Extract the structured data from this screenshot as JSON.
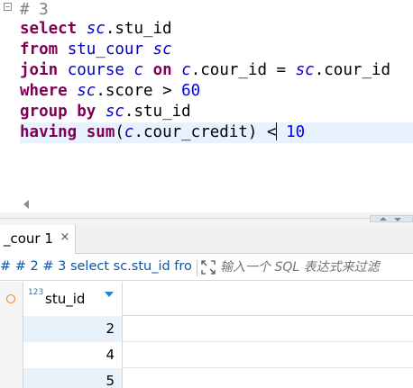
{
  "editor": {
    "line1": {
      "comment": "# 3"
    },
    "line2": {
      "kw1": "select",
      "alias": "sc",
      "rest": ".stu_id"
    },
    "line3": {
      "kw1": "from",
      "table": "stu_cour",
      "alias": "sc"
    },
    "line4": {
      "kw1": "join",
      "table": "course",
      "alias1": "c",
      "kw2": "on",
      "alias2": "c",
      "mid": ".cour_id = ",
      "alias3": "sc",
      "rest": ".cour_id"
    },
    "line5": {
      "kw1": "where",
      "alias": "sc",
      "rest": ".score > ",
      "num": "60"
    },
    "line6": {
      "kw1": "group by",
      "alias": "sc",
      "rest": ".stu_id"
    },
    "line7": {
      "kw1": "having",
      "func": "sum",
      "open": "(",
      "alias": "c",
      "rest": ".cour_credit) <",
      "num": "10"
    }
  },
  "results_tab": {
    "label": "_cour 1",
    "close": "×"
  },
  "filter_bar": {
    "query_text": "# # 2 # 3 select sc.stu_id fro",
    "placeholder": "输入一个 SQL 表达式来过滤"
  },
  "grid": {
    "column": {
      "type_badge": "123",
      "name": "stu_id"
    },
    "rows": [
      {
        "value": "2"
      },
      {
        "value": "4"
      },
      {
        "value": "5"
      }
    ]
  },
  "colors": {
    "keyword": "#7f0055",
    "alias": "#0000c0",
    "number": "#0000ff",
    "comment": "#808080",
    "query_link": "#0c55a8",
    "selection": "#e9f1fb"
  },
  "icons": [
    "fold-minus-icon",
    "scroll-left-icon",
    "close-icon",
    "expand-icon",
    "row-marker-icon",
    "sort-desc-icon"
  ]
}
